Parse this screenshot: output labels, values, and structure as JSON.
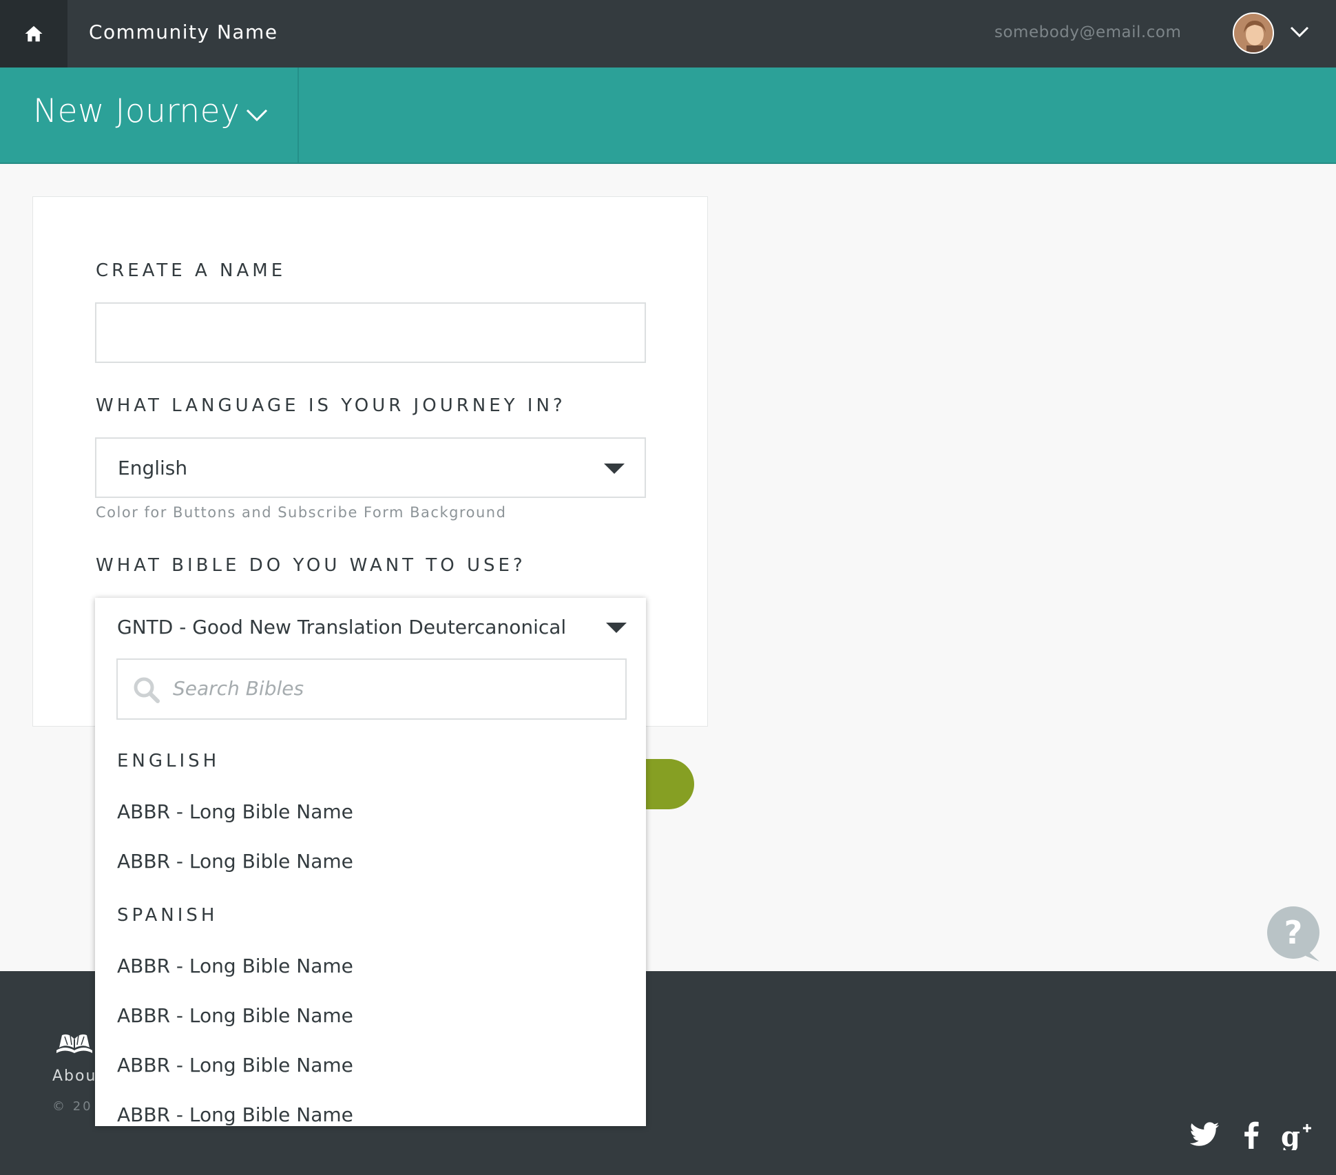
{
  "header": {
    "community_name": "Community Name",
    "email": "somebody@email.com"
  },
  "subheader": {
    "title": "New Journey"
  },
  "form": {
    "name_label": "CREATE A NAME",
    "name_value": "",
    "language_label": "WHAT LANGUAGE IS YOUR JOURNEY IN?",
    "language_value": "English",
    "language_hint": "Color for Buttons and Subscribe Form Background",
    "bible_label": "WHAT BIBLE DO YOU WANT TO USE?"
  },
  "bible_dropdown": {
    "selected": "GNTD - Good New Translation Deutercanonical",
    "search_placeholder": "Search Bibles",
    "groups": [
      {
        "name": "ENGLISH",
        "options": [
          "ABBR - Long Bible Name",
          "ABBR - Long Bible Name"
        ]
      },
      {
        "name": "SPANISH",
        "options": [
          "ABBR - Long Bible Name",
          "ABBR - Long Bible Name",
          "ABBR - Long Bible Name",
          "ABBR - Long Bible Name"
        ]
      }
    ]
  },
  "footer": {
    "about": "Abou",
    "copyright": "© 20"
  },
  "colors": {
    "topbar": "#343b3f",
    "accent_teal": "#2ca198",
    "button_green": "#869f23"
  },
  "icons": [
    "home-icon",
    "chevron-down-icon",
    "search-icon",
    "help-icon",
    "book-logo-icon",
    "twitter-icon",
    "facebook-icon",
    "google-plus-icon"
  ]
}
